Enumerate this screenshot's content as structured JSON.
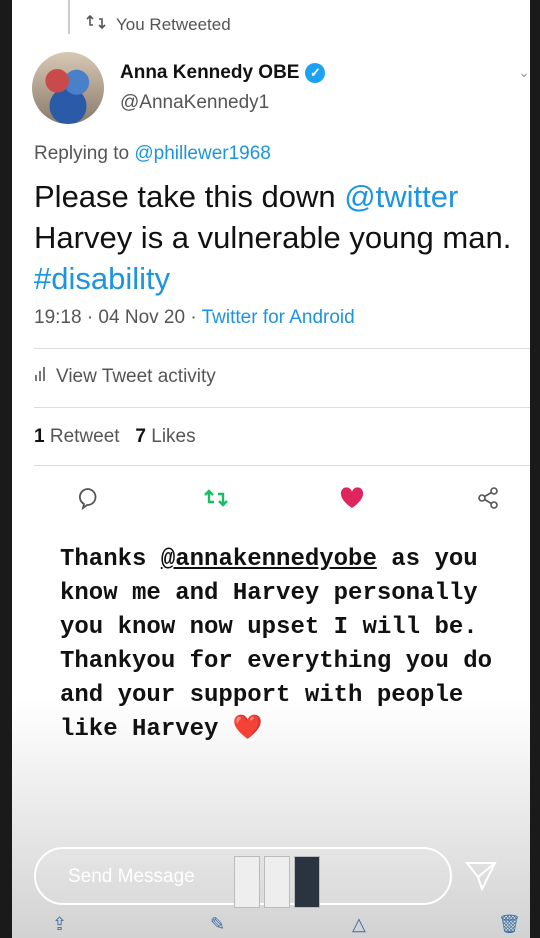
{
  "header": {
    "retweeted_label": "You Retweeted"
  },
  "author": {
    "name": "Anna Kennedy OBE",
    "handle": "@AnnaKennedy1"
  },
  "reply": {
    "prefix": "Replying to ",
    "mention": "@phillewer1968"
  },
  "tweet": {
    "part1": "Please take this down ",
    "link1": "@twitter",
    "part2": "Harvey is a vulnerable young man.",
    "hashtag": "#disability"
  },
  "meta": {
    "time": "19:18 · 04 Nov 20 · ",
    "source": "Twitter for Android"
  },
  "activity": {
    "label": "View Tweet activity"
  },
  "stats": {
    "retweets": "1",
    "retweets_label": "Retweet",
    "likes": "7",
    "likes_label": "Likes"
  },
  "story": {
    "prefix": "Thanks ",
    "mention": "@annakennedyobe",
    "body": " as you know me and Harvey personally you know now upset I will be. Thankyou for everything you do and your support with people like Harvey ",
    "emoji": "❤️"
  },
  "composer": {
    "placeholder": "Send Message"
  },
  "colors": {
    "link": "#1b95e0",
    "like": "#e0245e",
    "retweet": "#17bf63"
  },
  "icons": [
    "retweet-icon",
    "verified-icon",
    "chart-icon",
    "reply-icon",
    "heart-icon",
    "share-icon",
    "send-icon"
  ]
}
